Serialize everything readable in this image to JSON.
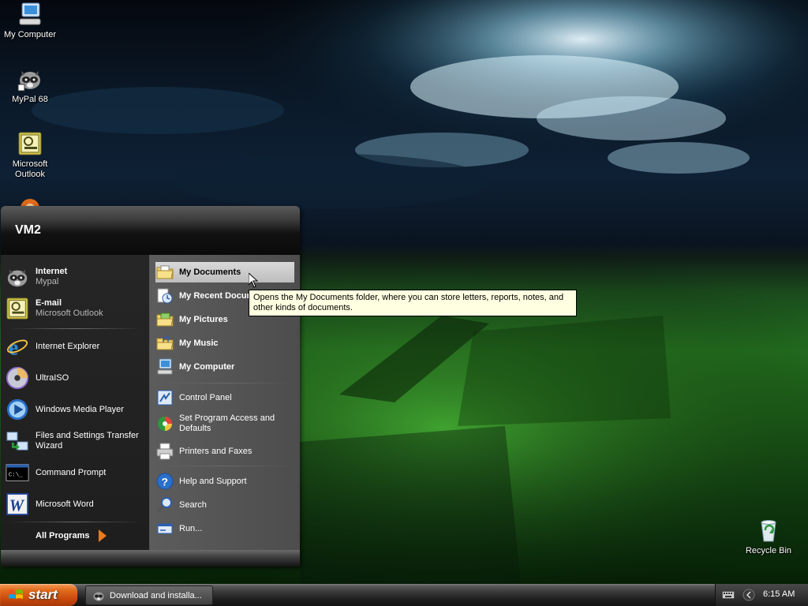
{
  "desktop": {
    "icons": [
      {
        "label": "My Computer",
        "icon": "my-computer-icon"
      },
      {
        "label": "MyPal 68",
        "icon": "mypal-icon"
      },
      {
        "label": "Microsoft Outlook",
        "icon": "outlook-icon"
      },
      {
        "label": "Recycle Bin",
        "icon": "recycle-bin-icon"
      }
    ]
  },
  "start_menu": {
    "user": "VM2",
    "pinned": [
      {
        "title": "Internet",
        "subtitle": "Mypal",
        "icon": "mypal-icon"
      },
      {
        "title": "E-mail",
        "subtitle": "Microsoft Outlook",
        "icon": "outlook-icon"
      }
    ],
    "recent": [
      {
        "label": "Internet Explorer",
        "icon": "internet-explorer-icon"
      },
      {
        "label": "UltraISO",
        "icon": "ultraiso-icon"
      },
      {
        "label": "Windows Media Player",
        "icon": "media-player-icon"
      },
      {
        "label": "Files and Settings Transfer Wizard",
        "icon": "transfer-wizard-icon"
      },
      {
        "label": "Command Prompt",
        "icon": "command-prompt-icon"
      },
      {
        "label": "Microsoft Word",
        "icon": "word-icon"
      }
    ],
    "all_programs": "All Programs",
    "places": [
      {
        "label": "My Documents",
        "icon": "documents-folder-icon",
        "bold": true,
        "selected": true
      },
      {
        "label": "My Recent Documents",
        "icon": "recent-documents-icon",
        "bold": true
      },
      {
        "label": "My Pictures",
        "icon": "pictures-folder-icon",
        "bold": true
      },
      {
        "label": "My Music",
        "icon": "music-folder-icon",
        "bold": true
      },
      {
        "label": "My Computer",
        "icon": "my-computer-icon",
        "bold": true
      }
    ],
    "settings": [
      {
        "label": "Control Panel",
        "icon": "control-panel-icon"
      },
      {
        "label": "Set Program Access and Defaults",
        "icon": "program-defaults-icon"
      },
      {
        "label": "Printers and Faxes",
        "icon": "printer-icon"
      }
    ],
    "help": [
      {
        "label": "Help and Support",
        "icon": "help-icon"
      },
      {
        "label": "Search",
        "icon": "search-icon"
      },
      {
        "label": "Run...",
        "icon": "run-icon"
      }
    ],
    "tooltip": "Opens the My Documents folder, where you can store letters, reports, notes, and other kinds of documents."
  },
  "taskbar": {
    "start_label": "start",
    "tasks": [
      {
        "label": "Download and installa...",
        "icon": "mypal-icon"
      }
    ],
    "clock": "6:15 AM",
    "tray_icons": [
      "keyboard-icon",
      "show-hidden-icons-icon"
    ]
  },
  "colors": {
    "start_button": "#e06a1c",
    "tooltip_bg": "#ffffe1",
    "menu_right_bg": "#555555",
    "menu_left_bg": "#222222"
  }
}
